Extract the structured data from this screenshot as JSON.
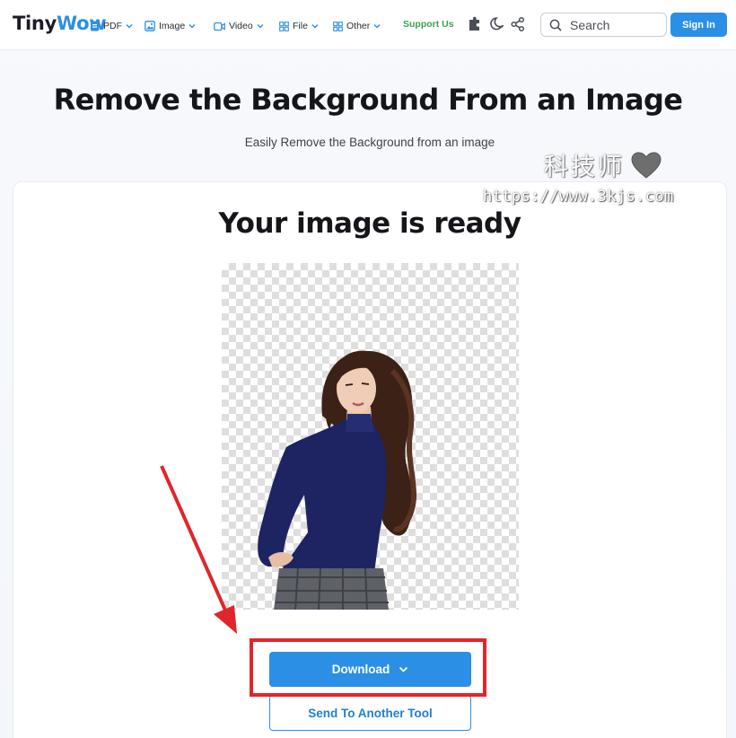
{
  "header": {
    "logo_part1": "Tiny",
    "logo_part2": "Wow",
    "nav": [
      {
        "label": "PDF",
        "icon": "pdf-icon"
      },
      {
        "label": "Image",
        "icon": "image-icon"
      },
      {
        "label": "Video",
        "icon": "video-icon"
      },
      {
        "label": "File",
        "icon": "file-icon"
      },
      {
        "label": "Other",
        "icon": "grid-icon"
      }
    ],
    "support_label": "Support Us",
    "icons": [
      "extension-icon",
      "moon-icon",
      "share-icon"
    ],
    "search_placeholder": "Search",
    "signin_label": "Sign In"
  },
  "hero": {
    "title": "Remove the Background From an Image",
    "subtitle": "Easily Remove the Background from an image"
  },
  "watermark": {
    "text": "科技师",
    "url": "https://www.3kjs.com"
  },
  "result": {
    "title": "Your image is ready",
    "download_label": "Download",
    "send_label": "Send To Another Tool"
  },
  "colors": {
    "accent": "#2b8fe6",
    "support": "#39a44a",
    "annotation": "#e0262b"
  }
}
